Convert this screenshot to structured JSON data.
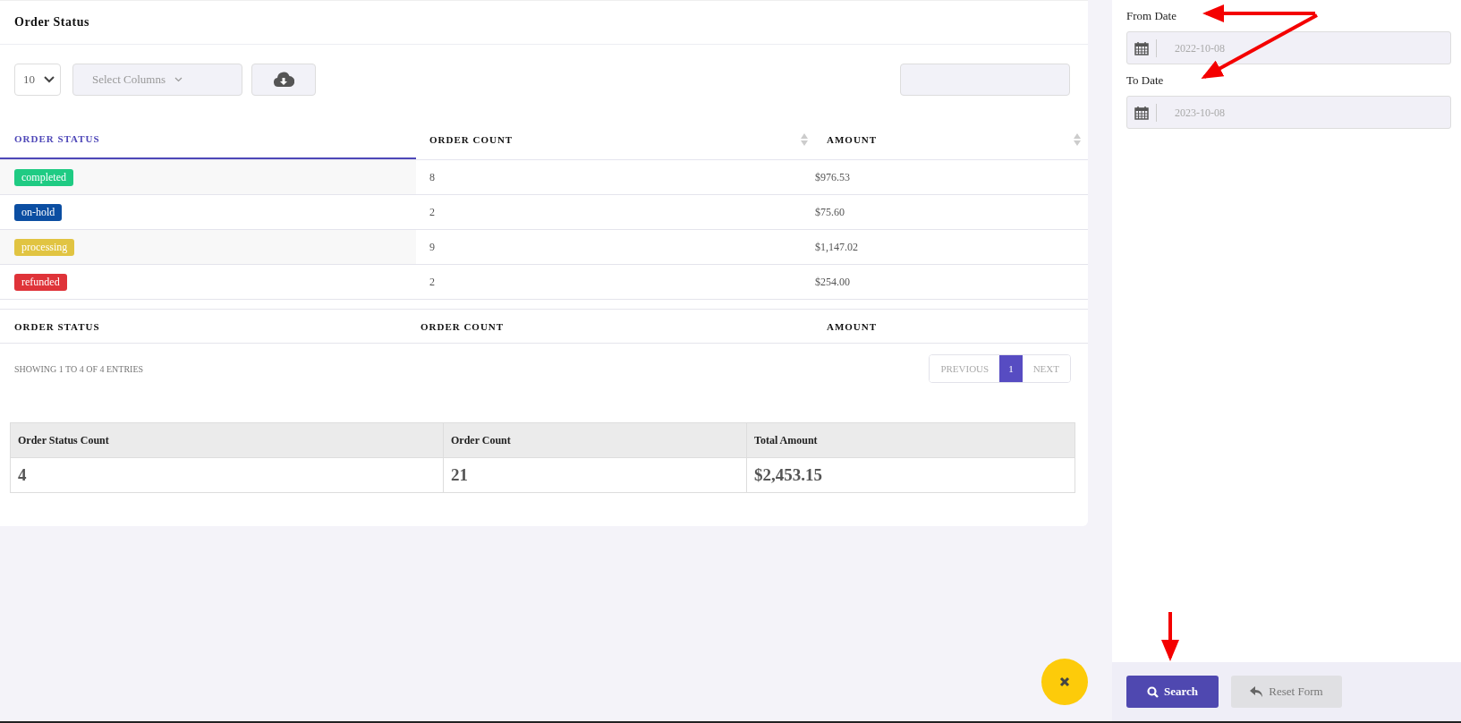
{
  "card": {
    "title": "Order Status"
  },
  "toolbar": {
    "page_size": "10",
    "column_select": {
      "placeholder": "Select Columns"
    }
  },
  "table": {
    "columns": [
      {
        "label": "ORDER STATUS",
        "selected": true,
        "sortable": false
      },
      {
        "label": "ORDER COUNT",
        "selected": false,
        "sortable": true
      },
      {
        "label": "AMOUNT",
        "selected": false,
        "sortable": true
      }
    ],
    "rows": [
      {
        "status": "completed",
        "color": "#1fcb83",
        "count": "8",
        "amount": "$976.53"
      },
      {
        "status": "on-hold",
        "color": "#0b4ea2",
        "count": "2",
        "amount": "$75.60"
      },
      {
        "status": "processing",
        "color": "#e1c442",
        "count": "9",
        "amount": "$1,147.02"
      },
      {
        "status": "refunded",
        "color": "#df3339",
        "count": "2",
        "amount": "$254.00"
      }
    ],
    "footer": [
      "ORDER STATUS",
      "ORDER COUNT",
      "AMOUNT"
    ]
  },
  "info": "SHOWING 1 TO 4 OF 4 ENTRIES",
  "pagination": [
    {
      "label": "PREVIOUS",
      "selected": false
    },
    {
      "label": "1",
      "selected": true
    },
    {
      "label": "NEXT",
      "selected": false
    }
  ],
  "summary": {
    "columns": [
      "Order Status Count",
      "Order Count",
      "Total Amount"
    ],
    "values": [
      "4",
      "21",
      "$2,453.15"
    ]
  },
  "filters": [
    {
      "label": "From Date",
      "value": "2022-10-08"
    },
    {
      "label": "To Date",
      "value": "2023-10-08"
    }
  ],
  "buttons": [
    {
      "kind": "primary",
      "label": "Search"
    },
    {
      "kind": "secondary",
      "label": "Reset Form"
    }
  ]
}
